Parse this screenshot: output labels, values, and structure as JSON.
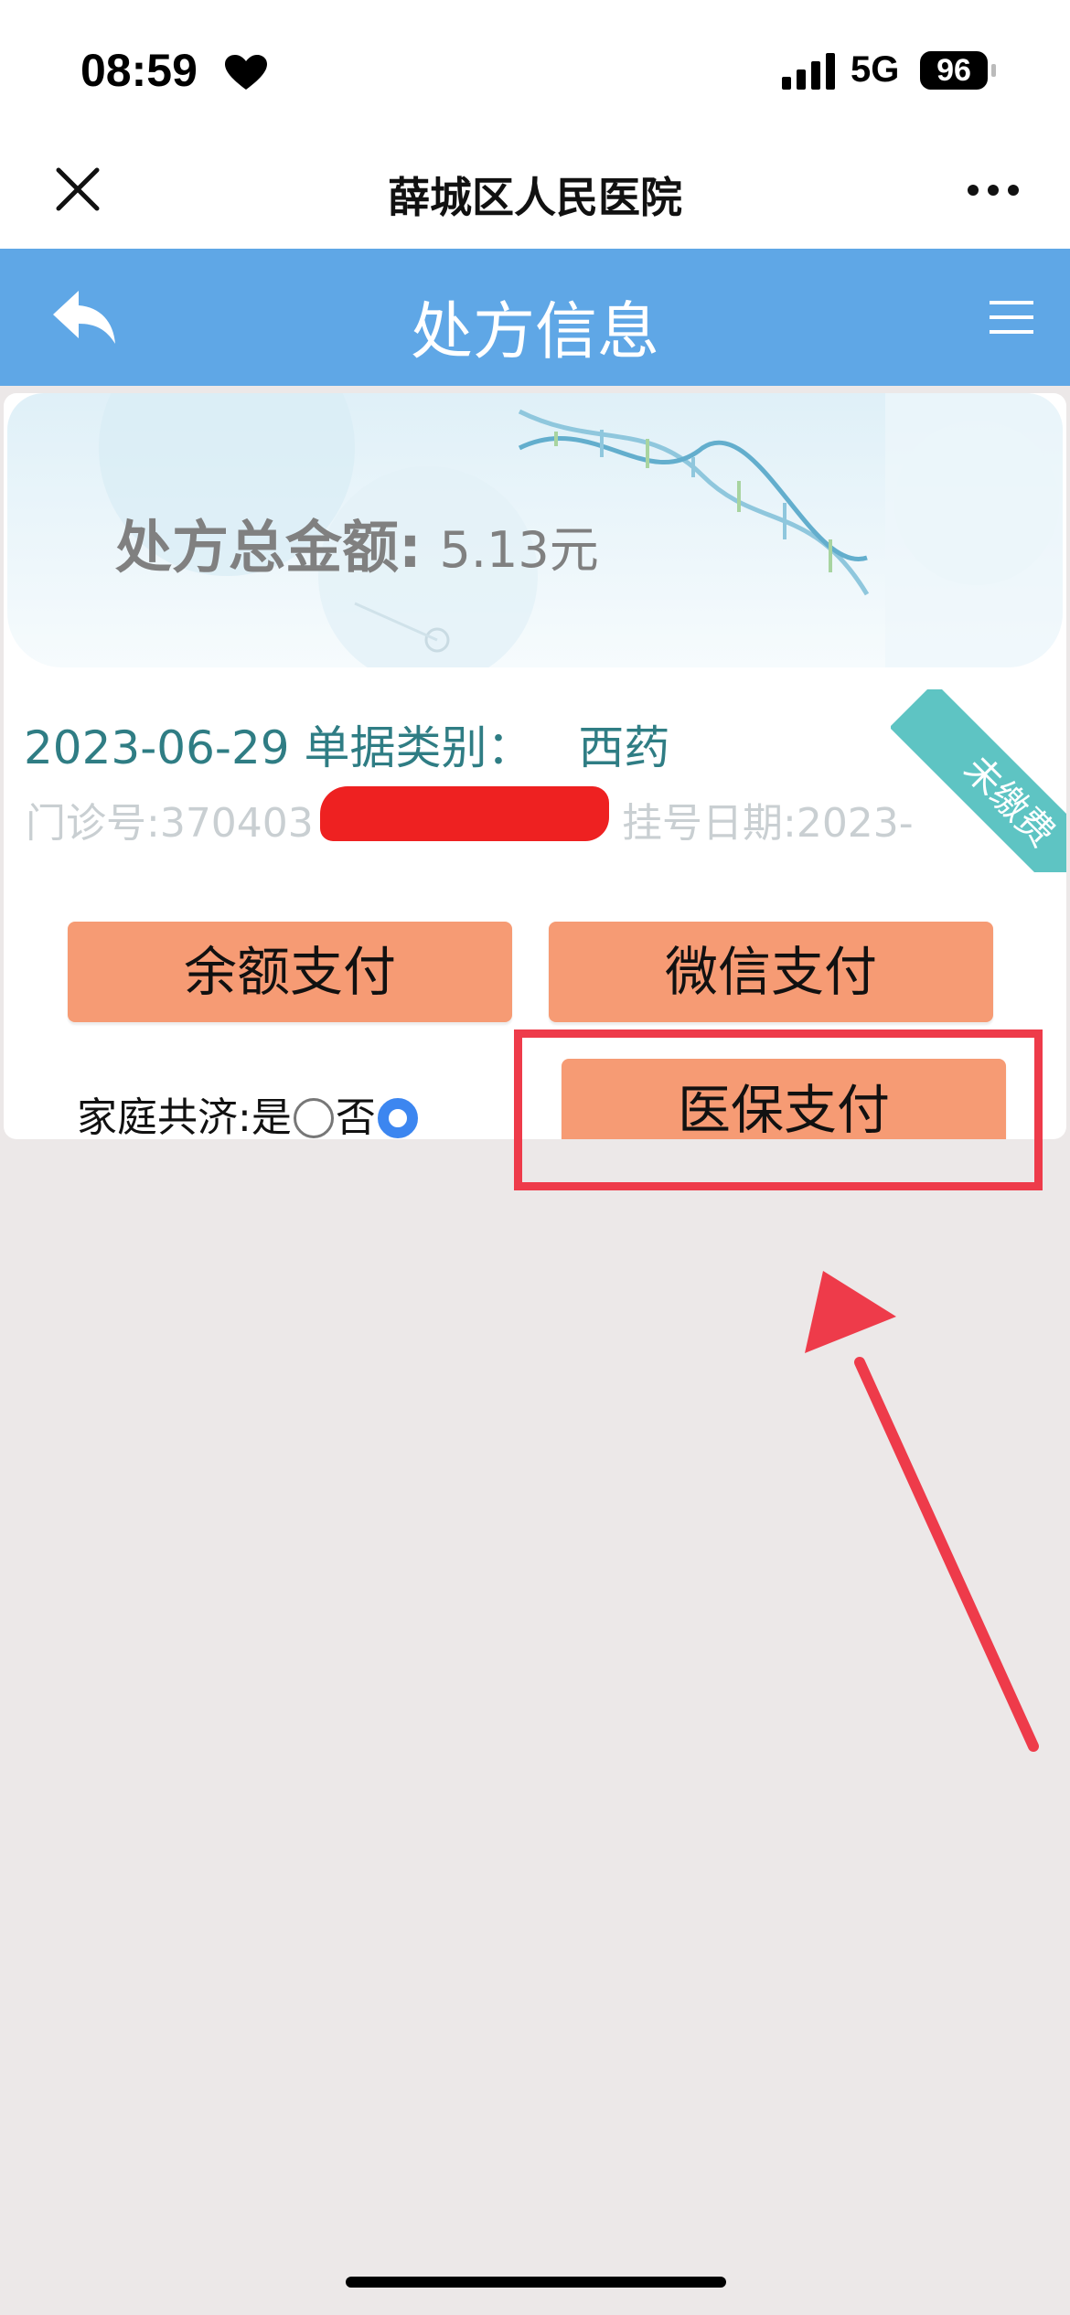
{
  "status_bar": {
    "time": "08:59",
    "network": "5G",
    "battery": "96"
  },
  "browser_bar": {
    "title": "薛城区人民医院"
  },
  "app_header": {
    "title": "处方信息"
  },
  "card": {
    "total_label": "处方总金额:",
    "total_value": "5.13元",
    "status": "未缴费",
    "date": "2023-06-29",
    "category_label": "单据类别：",
    "category_value": "西药",
    "clinic_no": "门诊号:370403",
    "reg_date": "挂号日期:2023-",
    "family_share_label": "家庭共济:",
    "option_yes": "是",
    "option_no": "否",
    "selected_option": "否"
  },
  "buttons": {
    "balance_pay": "余额支付",
    "wechat_pay": "微信支付",
    "medical_insurance_pay": "医保支付"
  },
  "colors": {
    "header_blue": "#5fa7e6",
    "button_orange": "#f69b74",
    "ribbon_teal": "#5ec4c3",
    "annotation_red": "#ee3b4a",
    "text_teal": "#2f7d84"
  }
}
